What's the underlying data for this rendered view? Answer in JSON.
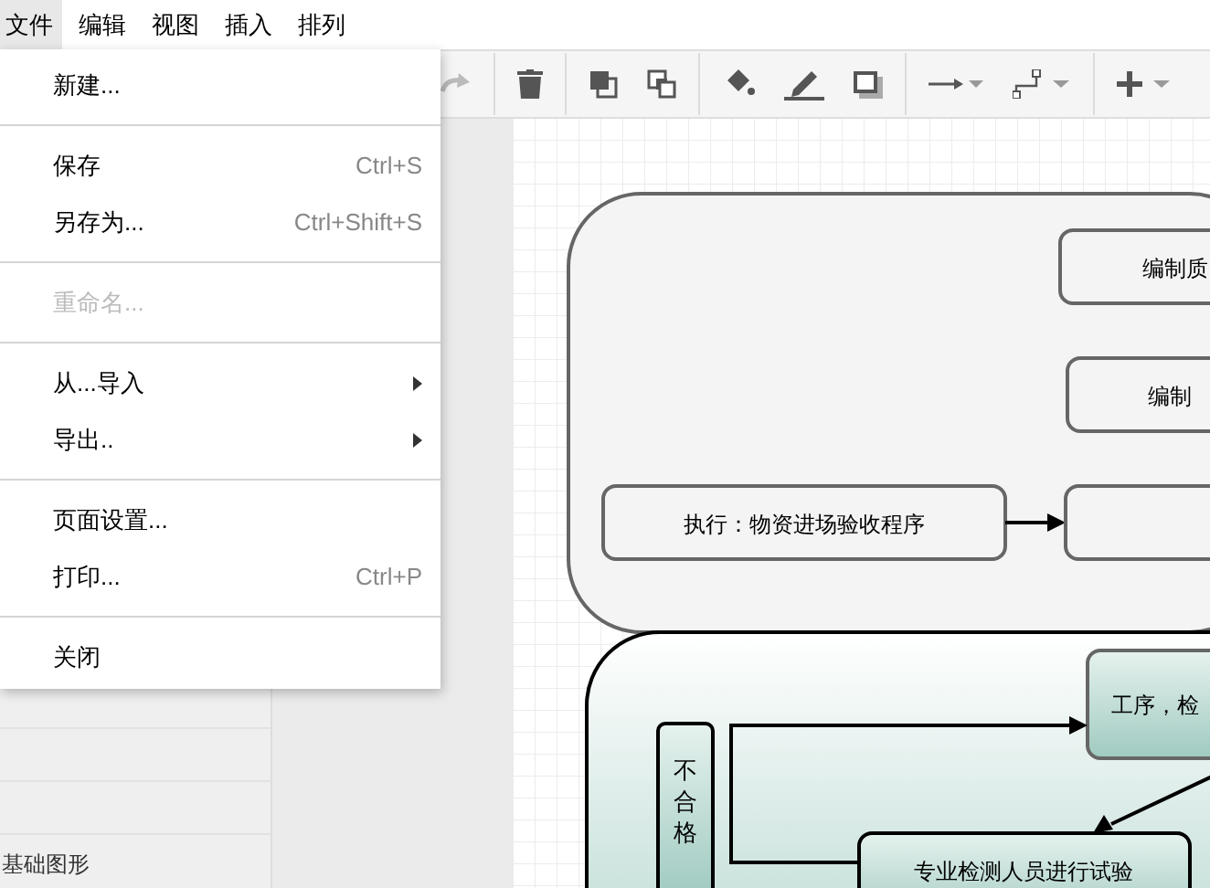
{
  "menubar": [
    {
      "label": "文件",
      "selected": true
    },
    {
      "label": "编辑",
      "selected": false
    },
    {
      "label": "视图",
      "selected": false
    },
    {
      "label": "插入",
      "selected": false
    },
    {
      "label": "排列",
      "selected": false
    }
  ],
  "file_menu": [
    {
      "kind": "item",
      "label": "新建...",
      "disabled": false,
      "submenu": false
    },
    {
      "kind": "separator"
    },
    {
      "kind": "item",
      "label": "保存",
      "shortcut": "Ctrl+S",
      "disabled": false,
      "submenu": false
    },
    {
      "kind": "item",
      "label": "另存为...",
      "shortcut": "Ctrl+Shift+S",
      "disabled": false,
      "submenu": false
    },
    {
      "kind": "separator"
    },
    {
      "kind": "item",
      "label": "重命名...",
      "disabled": true,
      "submenu": false
    },
    {
      "kind": "separator"
    },
    {
      "kind": "item",
      "label": "从...导入",
      "disabled": false,
      "submenu": true
    },
    {
      "kind": "item",
      "label": "导出..",
      "disabled": false,
      "submenu": true
    },
    {
      "kind": "separator"
    },
    {
      "kind": "item",
      "label": "页面设置...",
      "disabled": false,
      "submenu": false
    },
    {
      "kind": "item",
      "label": "打印...",
      "shortcut": "Ctrl+P",
      "disabled": false,
      "submenu": false
    },
    {
      "kind": "separator"
    },
    {
      "kind": "item",
      "label": "关闭",
      "disabled": false,
      "submenu": false
    }
  ],
  "sidebar": {
    "section": "基础图形"
  },
  "diagram": {
    "nodes": [
      "编制质",
      "编制",
      "执行：物资进场验收程序",
      "工序，检",
      "不合格",
      "专业检测人员进行试验"
    ]
  }
}
